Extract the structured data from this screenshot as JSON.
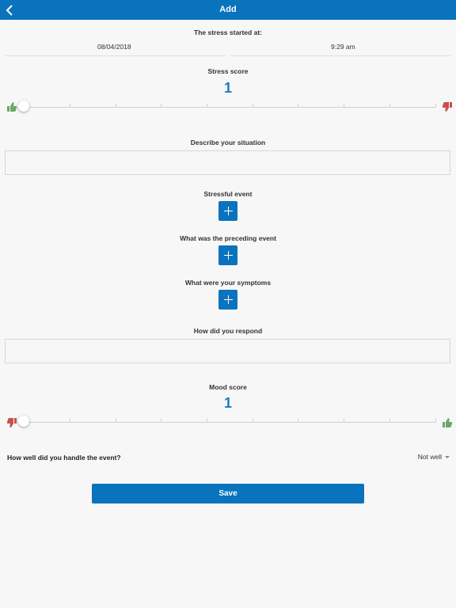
{
  "nav": {
    "title": "Add",
    "back_icon": "chevron-left-icon"
  },
  "stress_started": {
    "label": "The stress started at:",
    "date": "08/04/2018",
    "time": "9:29 am"
  },
  "stress_score": {
    "label": "Stress score",
    "value": "1",
    "slider_fraction": 0.0,
    "left_icon": "thumbs-up-icon",
    "right_icon": "thumbs-down-icon"
  },
  "describe": {
    "label": "Describe your situation",
    "value": ""
  },
  "stressful_event": {
    "label": "Stressful event",
    "add_icon": "plus-icon"
  },
  "preceding_event": {
    "label": "What was the preceding event",
    "add_icon": "plus-icon"
  },
  "symptoms": {
    "label": "What were your symptoms",
    "add_icon": "plus-icon"
  },
  "respond": {
    "label": "How did you respond",
    "value": ""
  },
  "mood_score": {
    "label": "Mood score",
    "value": "1",
    "slider_fraction": 0.0,
    "left_icon": "thumbs-down-icon",
    "right_icon": "thumbs-up-icon"
  },
  "handle": {
    "question": "How well did you handle the event?",
    "selected": "Not well"
  },
  "save_label": "Save",
  "colors": {
    "accent": "#0a73bd",
    "thumbs_up": "#6aa86a",
    "thumbs_down": "#c9504b",
    "score": "#1a7bc0"
  }
}
